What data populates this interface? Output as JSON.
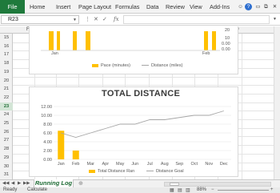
{
  "ribbon": {
    "file": "File",
    "tabs": [
      "Home",
      "Insert",
      "Page Layout",
      "Formulas",
      "Data",
      "Review",
      "View",
      "Add-Ins"
    ]
  },
  "formula_bar": {
    "name_box": "R23",
    "formula": ""
  },
  "columns": [
    "F",
    "G",
    "H",
    "I",
    "J",
    "K",
    "L",
    "M",
    "N",
    "O"
  ],
  "rows": [
    "15",
    "16",
    "17",
    "18",
    "19",
    "20",
    "21",
    "22",
    "23",
    "24",
    "25",
    "26",
    "27",
    "28",
    "29",
    "30",
    "31"
  ],
  "active_row": "23",
  "chart_top": {
    "x_labels": [
      "Jan",
      "Feb"
    ],
    "y2_ticks": [
      "20",
      "10",
      "0.00",
      "0.00"
    ],
    "legend": [
      "Pace (minutes)",
      "Distance (miles)"
    ]
  },
  "chart_data": {
    "type": "bar",
    "title": "TOTAL DISTANCE",
    "categories": [
      "Jan",
      "Feb",
      "Mar",
      "Apr",
      "May",
      "Jun",
      "Jul",
      "Aug",
      "Sep",
      "Oct",
      "Nov",
      "Dec"
    ],
    "series": [
      {
        "name": "Total Distance Ran",
        "type": "bar",
        "values": [
          6.5,
          2,
          0,
          0,
          0,
          0,
          0,
          0,
          0,
          0,
          0,
          0
        ]
      },
      {
        "name": "Distance Goal",
        "type": "line",
        "values": [
          6,
          5,
          6,
          7,
          8,
          8,
          9,
          9,
          9.5,
          10,
          10,
          11
        ]
      }
    ],
    "ylim": [
      0,
      12
    ],
    "yticks": [
      "12.00",
      "10.00",
      "8.00",
      "6.00",
      "4.00",
      "2.00",
      "0.00"
    ],
    "colors": {
      "bar": "#ffc000",
      "line": "#a6a6a6"
    }
  },
  "sheet_tabs": {
    "active": "Running Log"
  },
  "status": {
    "left": "Ready",
    "calc": "Calculate",
    "zoom": "88%"
  }
}
